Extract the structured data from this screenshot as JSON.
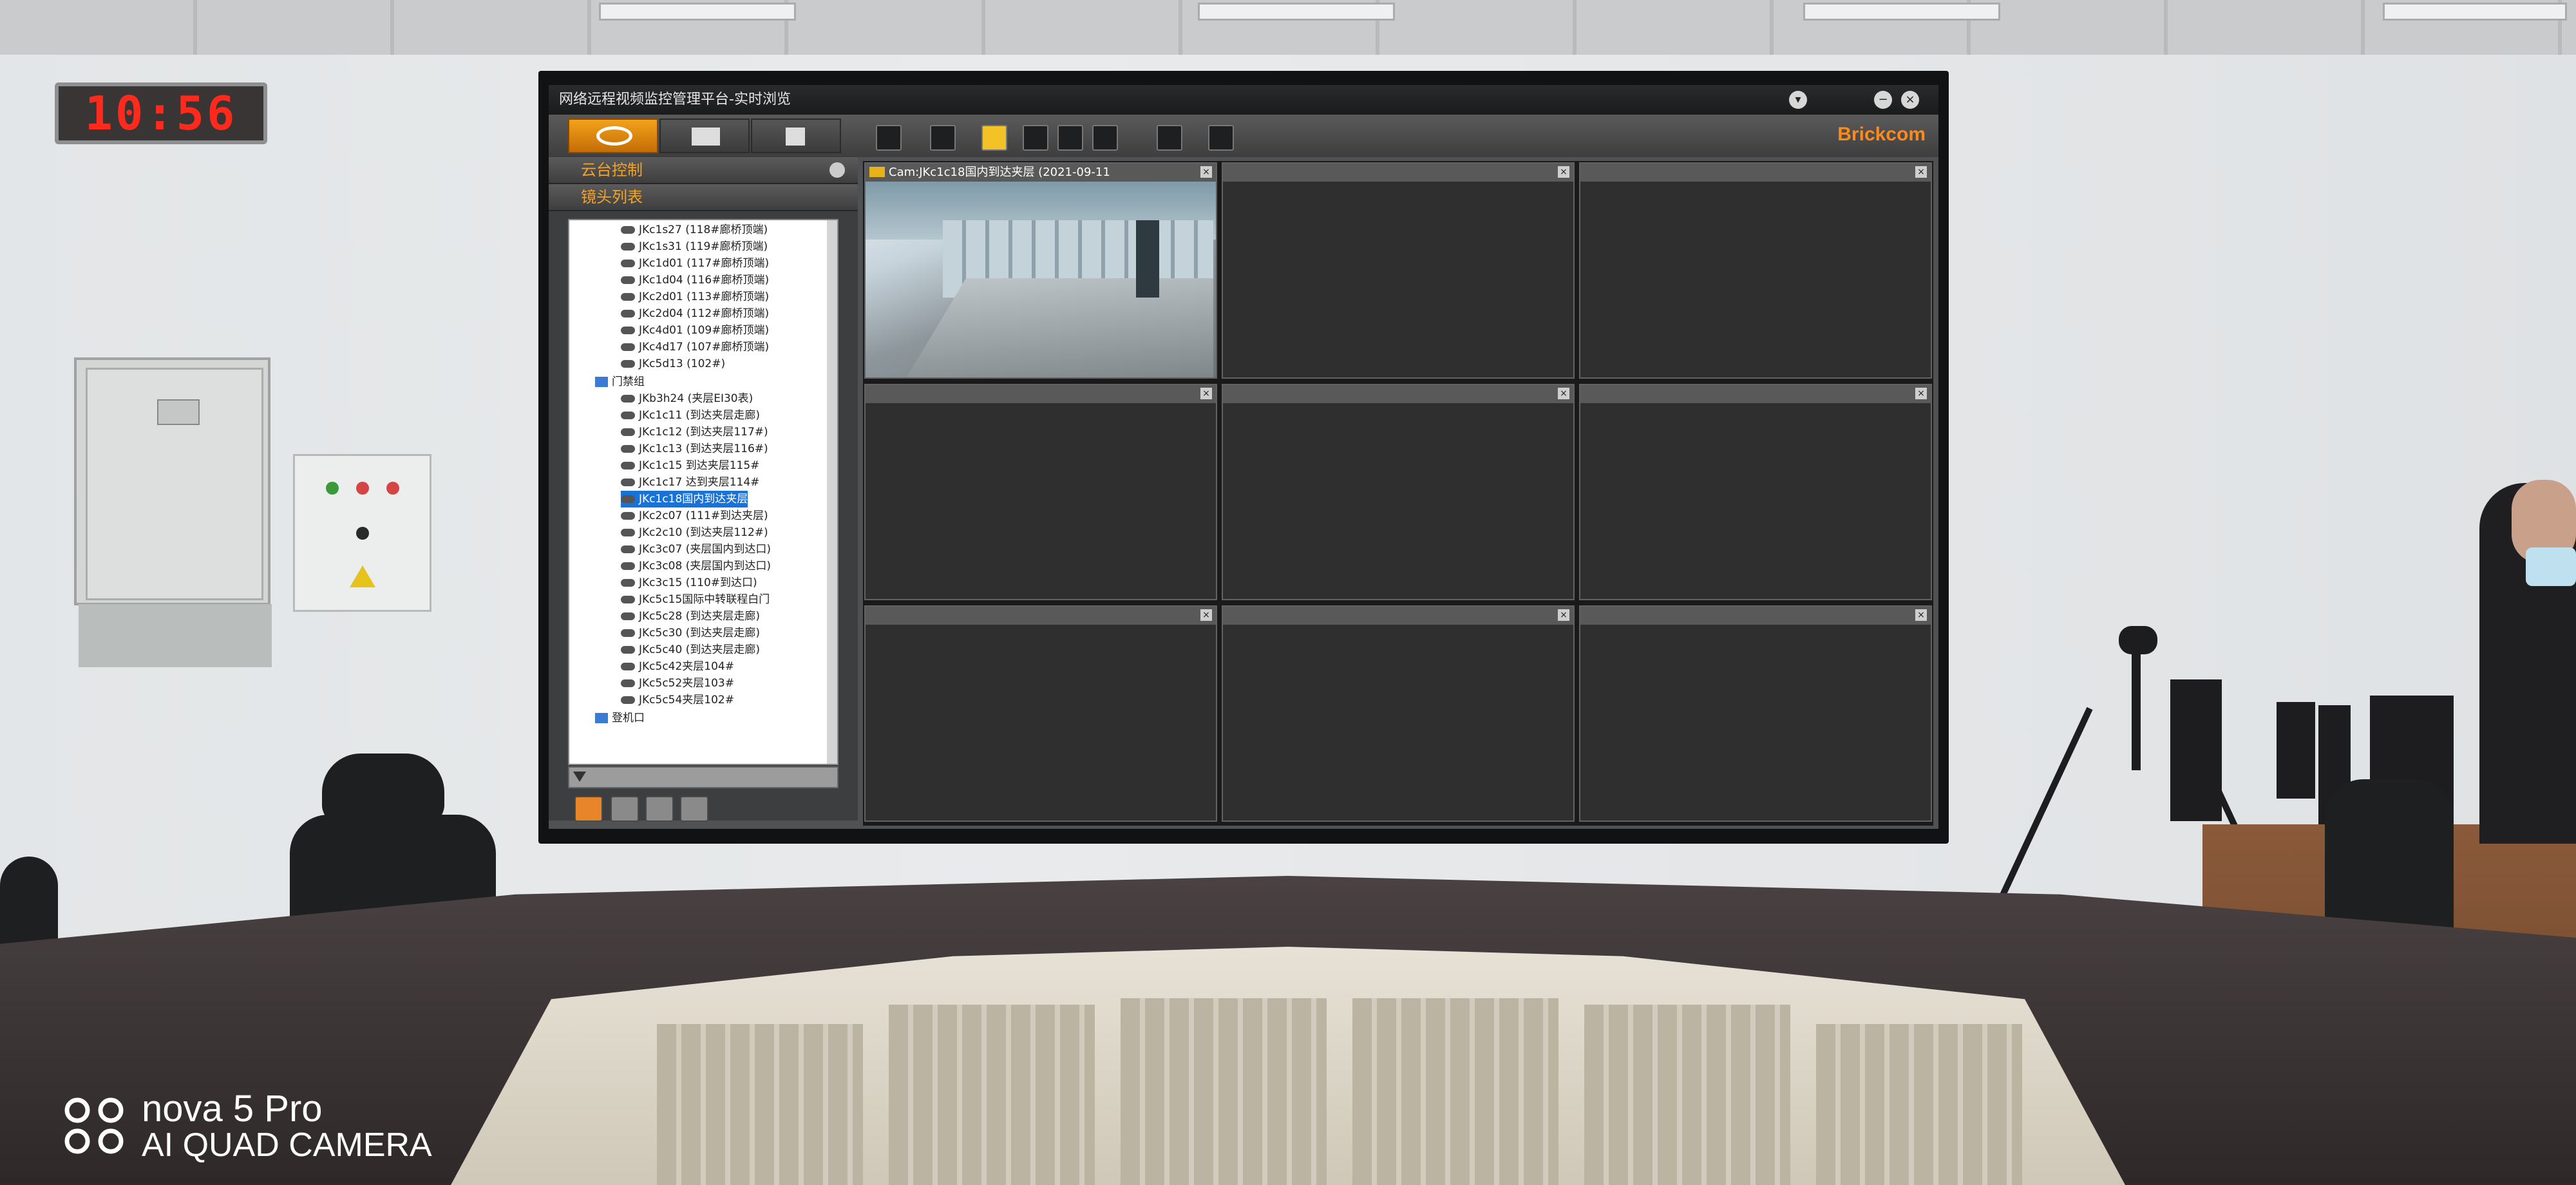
{
  "clock": {
    "time": "10:56"
  },
  "app": {
    "title": "网络远程视频监控管理平台-实时浏览",
    "brand": "Brickcom",
    "minimize": "−",
    "close": "×"
  },
  "sidebar": {
    "ptz_header": "云台控制",
    "camera_list_header": "镜头列表",
    "group_header": "门禁组",
    "airport_group": "登机口",
    "cameras_top": [
      "JKc1s27 (118#廊桥顶端)",
      "JKc1s31 (119#廊桥顶端)",
      "JKc1d01 (117#廊桥顶端)",
      "JKc1d04 (116#廊桥顶端)",
      "JKc2d01 (113#廊桥顶端)",
      "JKc2d04 (112#廊桥顶端)",
      "JKc4d01 (109#廊桥顶端)",
      "JKc4d17 (107#廊桥顶端)",
      "JKc5d13 (102#)"
    ],
    "cameras_group": [
      "JKb3h24 (夹层EI30表)",
      "JKc1c11 (到达夹层走廊)",
      "JKc1c12 (到达夹层117#)",
      "JKc1c13 (到达夹层116#)",
      "JKc1c15 到达夹层115#",
      "JKc1c17 达到夹层114#",
      "JKc1c18国内到达夹层",
      "JKc2c07 (111#到达夹层)",
      "JKc2c10 (到达夹层112#)",
      "JKc3c07 (夹层国内到达口)",
      "JKc3c08 (夹层国内到达口)",
      "JKc3c15 (110#到达口)",
      "JKc5c15国际中转联程白门",
      "JKc5c28 (到达夹层走廊)",
      "JKc5c30 (到达夹层走廊)",
      "JKc5c40 (到达夹层走廊)",
      "JKc5c42夹层104#",
      "JKc5c52夹层103#",
      "JKc5c54夹层102#"
    ],
    "selected_index": 6
  },
  "video_grid": {
    "active_caption": "Cam:JKc1c18国内到达夹层 (2021-09-11",
    "cell_count": 9
  },
  "watermark": {
    "line1": "nova 5 Pro",
    "line2": "AI QUAD CAMERA"
  }
}
